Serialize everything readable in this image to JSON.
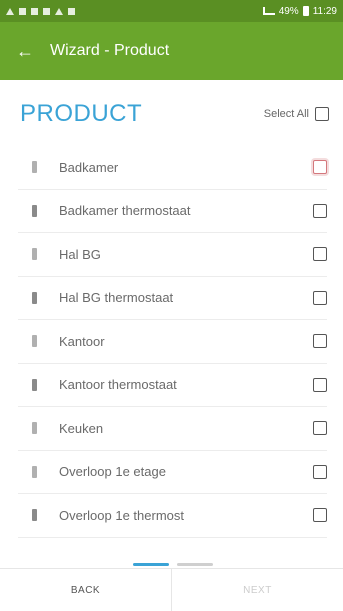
{
  "status_bar": {
    "time": "11:29",
    "battery": "49%"
  },
  "app_bar": {
    "back_icon": "arrow-left-icon",
    "title": "Wizard - Product"
  },
  "header": {
    "title": "PRODUCT",
    "select_all_label": "Select All"
  },
  "items": [
    {
      "label": "Badkamer",
      "icon": "device-icon",
      "checked": false,
      "focused": true
    },
    {
      "label": "Badkamer thermostaat",
      "icon": "thermostat-icon",
      "checked": false,
      "focused": false
    },
    {
      "label": "Hal BG",
      "icon": "device-icon",
      "checked": false,
      "focused": false
    },
    {
      "label": "Hal BG thermostaat",
      "icon": "thermostat-icon",
      "checked": false,
      "focused": false
    },
    {
      "label": "Kantoor",
      "icon": "device-icon",
      "checked": false,
      "focused": false
    },
    {
      "label": "Kantoor thermostaat",
      "icon": "thermostat-icon",
      "checked": false,
      "focused": false
    },
    {
      "label": "Keuken",
      "icon": "device-icon",
      "checked": false,
      "focused": false
    },
    {
      "label": "Overloop 1e etage",
      "icon": "device-icon",
      "checked": false,
      "focused": false
    },
    {
      "label": "Overloop 1e thermost",
      "icon": "thermostat-icon",
      "checked": false,
      "focused": false
    }
  ],
  "footer": {
    "back_label": "BACK",
    "next_label": "NEXT"
  },
  "colors": {
    "app_bar": "#6aa62c",
    "status_bar": "#5a8f23",
    "title_accent": "#3aa3d6",
    "focus_border": "#d4787d"
  }
}
